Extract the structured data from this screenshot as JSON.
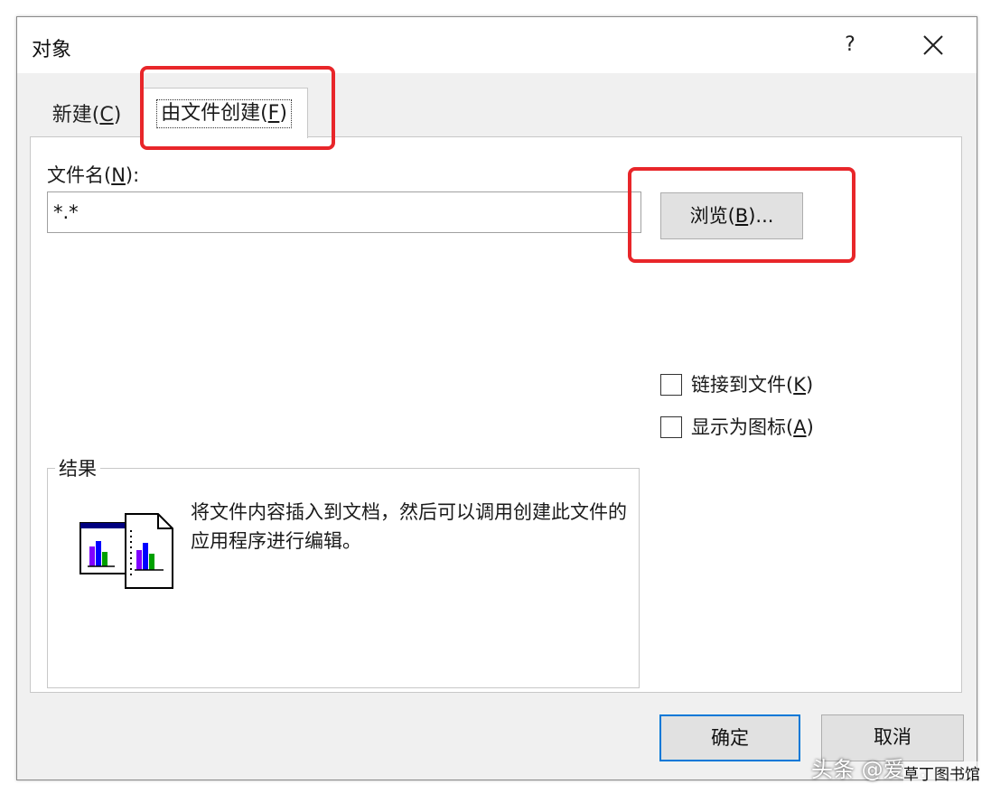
{
  "window": {
    "title": "对象",
    "help": "?",
    "close_icon": "close-icon"
  },
  "tabs": [
    {
      "label": "新建(",
      "mnemonic": "C",
      "suffix": ")"
    },
    {
      "label": "由文件创建(",
      "mnemonic": "F",
      "suffix": ")"
    }
  ],
  "filename": {
    "label_prefix": "文件名(",
    "label_mnemonic": "N",
    "label_suffix": "):",
    "value": "*.*"
  },
  "browse": {
    "prefix": "浏览(",
    "mnemonic": "B",
    "suffix": ")..."
  },
  "options": {
    "link": {
      "prefix": "链接到文件(",
      "mnemonic": "K",
      "suffix": ")",
      "checked": false
    },
    "icon": {
      "prefix": "显示为图标(",
      "mnemonic": "A",
      "suffix": ")",
      "checked": false
    }
  },
  "result": {
    "legend": "结果",
    "text": "将文件内容插入到文档，然后可以调用创建此文件的应用程序进行编辑。"
  },
  "buttons": {
    "ok": "确定",
    "cancel": "取消"
  },
  "watermark": {
    "text": "头条 @爱…",
    "site": "草丁图书馆"
  },
  "colors": {
    "highlight": "#e8262a",
    "focus_border": "#0078d7"
  }
}
